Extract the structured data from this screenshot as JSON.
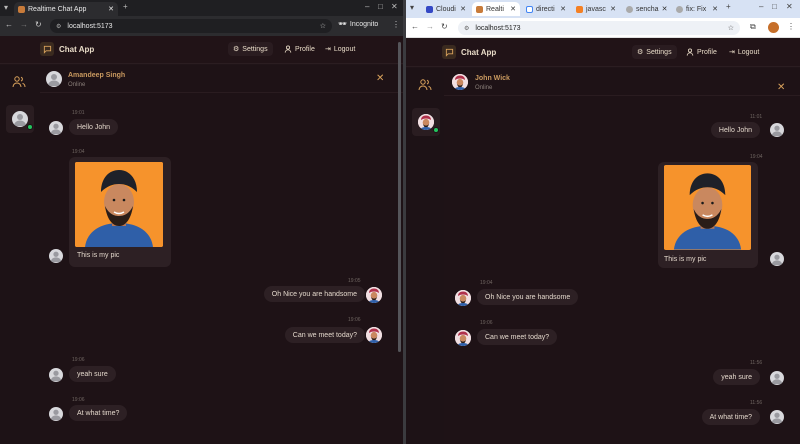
{
  "browser_left": {
    "tab_title": "Realtime Chat App",
    "url": "localhost:5173",
    "mode_label": "Incognito"
  },
  "browser_right": {
    "tabs": [
      "Cloudi",
      "Realti",
      "directi",
      "javasc",
      "sencha",
      "fix: Fix"
    ],
    "url": "localhost:5173"
  },
  "app": {
    "title": "Chat App",
    "nav": {
      "settings": "Settings",
      "profile": "Profile",
      "logout": "Logout"
    }
  },
  "left_chat": {
    "contact_name": "Amandeep Singh",
    "contact_status": "Online",
    "messages": [
      {
        "time": "19:01",
        "text": "Hello John",
        "side": "in"
      },
      {
        "time": "19:04",
        "text": "This is my pic",
        "side": "in",
        "image": true
      },
      {
        "time": "19:05",
        "text": "Oh Nice you are handsome",
        "side": "out"
      },
      {
        "time": "19:06",
        "text": "Can we meet today?",
        "side": "out"
      },
      {
        "time": "19:06",
        "text": "yeah sure",
        "side": "in"
      },
      {
        "time": "19:06",
        "text": "At what time?",
        "side": "in"
      }
    ]
  },
  "right_chat": {
    "contact_name": "John Wick",
    "contact_status": "Online",
    "messages": [
      {
        "time": "11:01",
        "text": "Hello John",
        "side": "out"
      },
      {
        "time": "19:04",
        "text": "This is my pic",
        "side": "out",
        "image": true
      },
      {
        "time": "19:04",
        "text": "Oh Nice you are handsome",
        "side": "in"
      },
      {
        "time": "19:06",
        "text": "Can we meet today?",
        "side": "in"
      },
      {
        "time": "11:56",
        "text": "yeah sure",
        "side": "out"
      },
      {
        "time": "11:56",
        "text": "At what time?",
        "side": "out"
      }
    ]
  },
  "colors": {
    "accent": "#d9a25c",
    "bubble": "#2d2024",
    "background": "#1e1216",
    "online": "#22c55e"
  },
  "icons": [
    "menu-icon",
    "close-icon",
    "plus-icon",
    "reload-icon",
    "back-icon",
    "forward-icon",
    "star-icon",
    "incognito-icon",
    "more-icon",
    "chat-logo-icon",
    "gear-icon",
    "user-icon",
    "logout-icon",
    "users-icon",
    "x-icon"
  ]
}
